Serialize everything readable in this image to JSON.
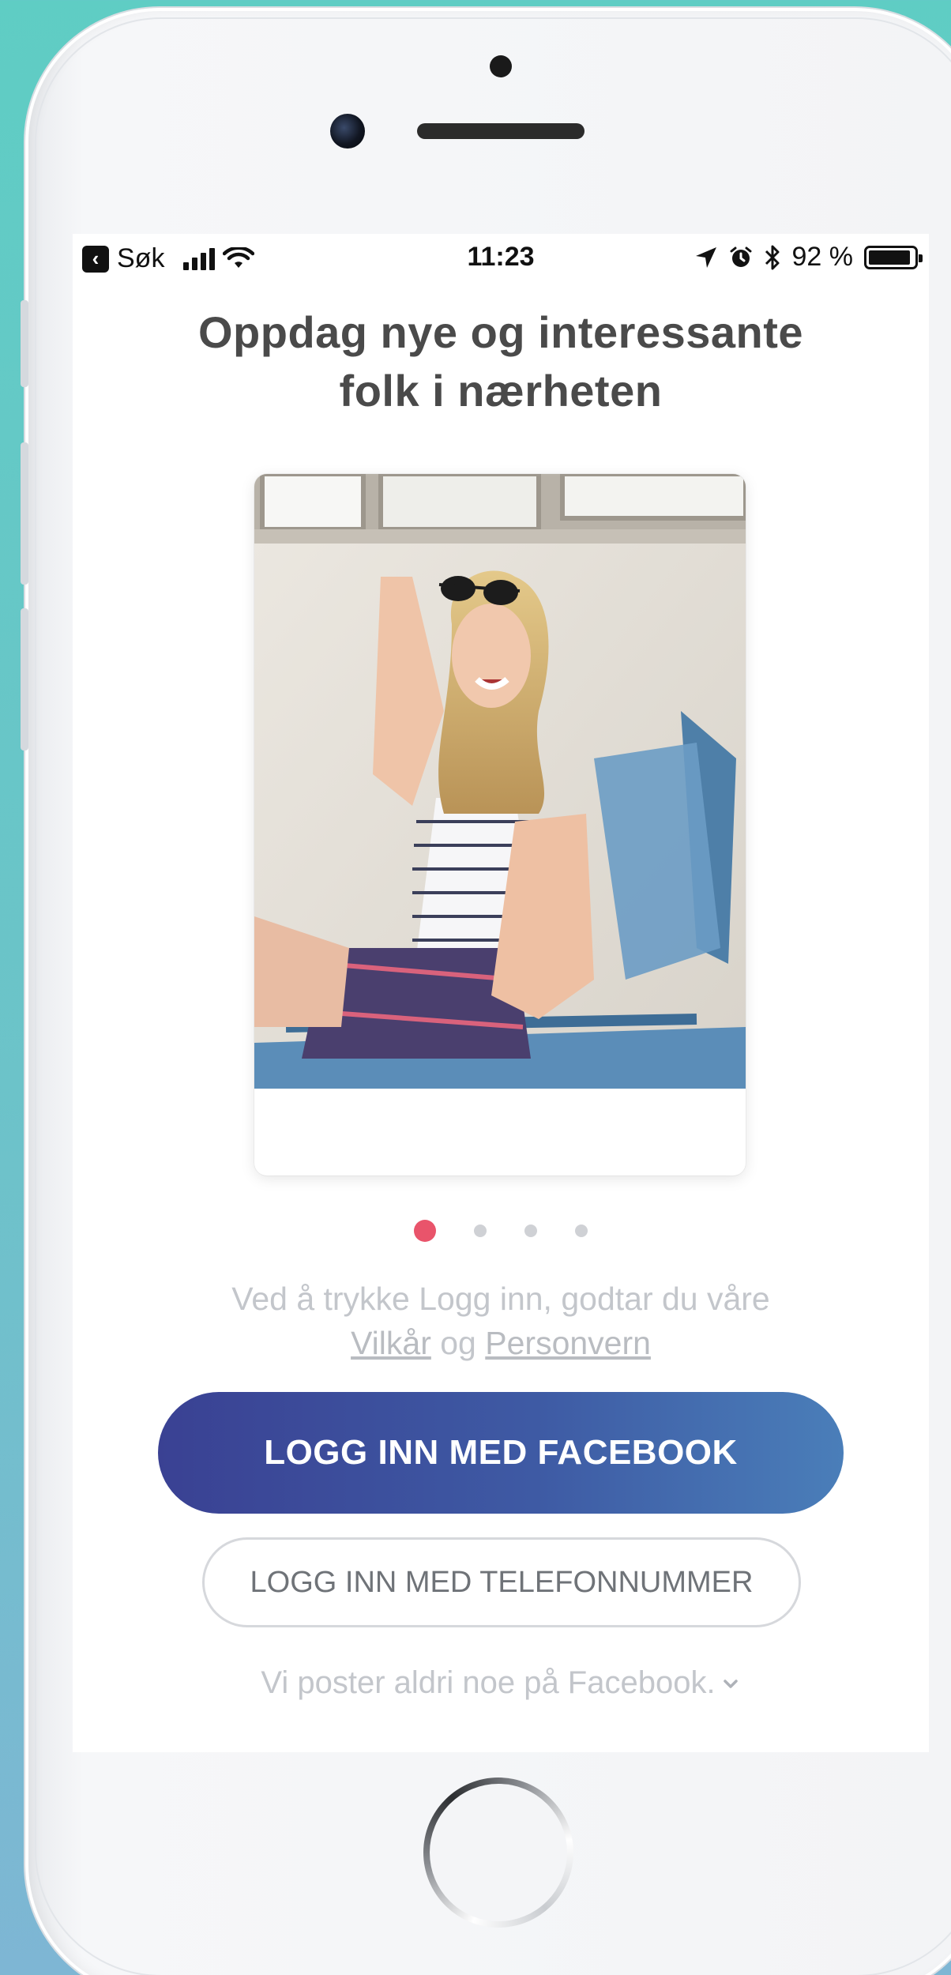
{
  "status_bar": {
    "back_label": "Søk",
    "time": "11:23",
    "battery": "92 %",
    "battery_level": 0.92
  },
  "headline": {
    "line1": "Oppdag nye og interessante",
    "line2": "folk i nærheten"
  },
  "carousel": {
    "count": 4,
    "active_index": 0
  },
  "terms": {
    "line1": "Ved å trykke Logg inn, godtar du våre",
    "terms_link": "Vilkår",
    "connector": "og",
    "privacy_link": "Personvern"
  },
  "buttons": {
    "facebook": "LOGG INN MED FACEBOOK",
    "phone": "LOGG INN MED TELEFONNUMMER"
  },
  "footer_note": "Vi poster aldri noe på Facebook.",
  "colors": {
    "accent": "#e9546b",
    "facebook_gradient_start": "#3a4193",
    "facebook_gradient_end": "#4a7eb9"
  }
}
